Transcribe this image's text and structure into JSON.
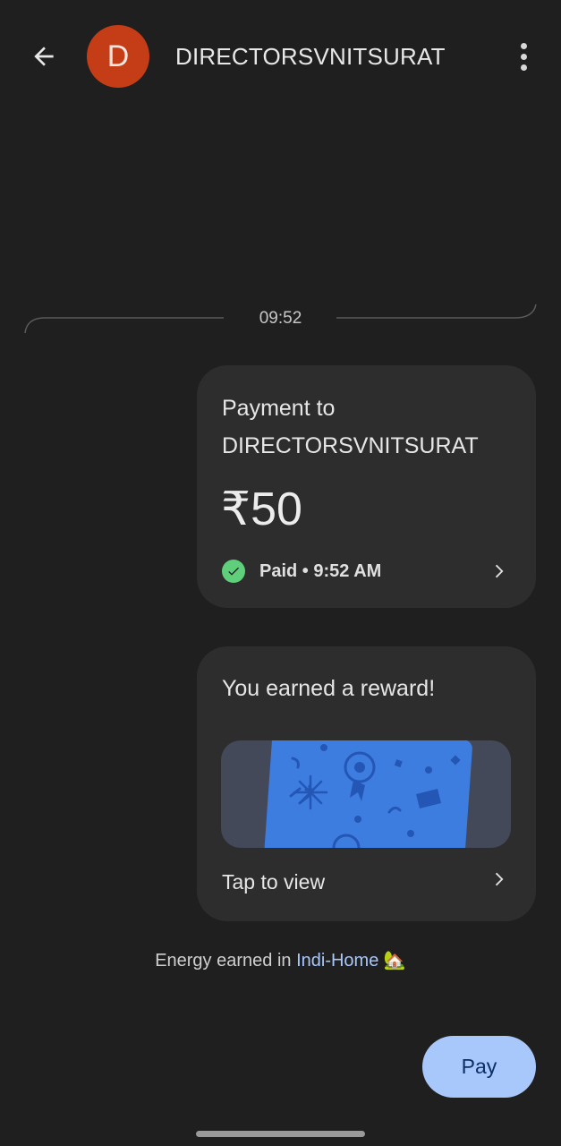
{
  "header": {
    "avatar_letter": "D",
    "title": "DIRECTORSVNITSURAT"
  },
  "timestamp": "09:52",
  "payment_card": {
    "line1": "Payment to",
    "line2": "DIRECTORSVNITSURAT",
    "amount": "₹50",
    "status": "Paid • 9:52 AM",
    "status_color": "#5fcf7c"
  },
  "reward_card": {
    "title": "You earned a reward!",
    "action": "Tap to view"
  },
  "energy": {
    "prefix": "Energy earned in ",
    "link": "Indi-Home",
    "emoji": "🏡"
  },
  "pay_button": {
    "label": "Pay"
  },
  "colors": {
    "background": "#1f1f1f",
    "card": "#2d2d2d",
    "avatar": "#c43d16",
    "accent": "#a8c7fa",
    "reward_blue": "#3d7ddf"
  }
}
